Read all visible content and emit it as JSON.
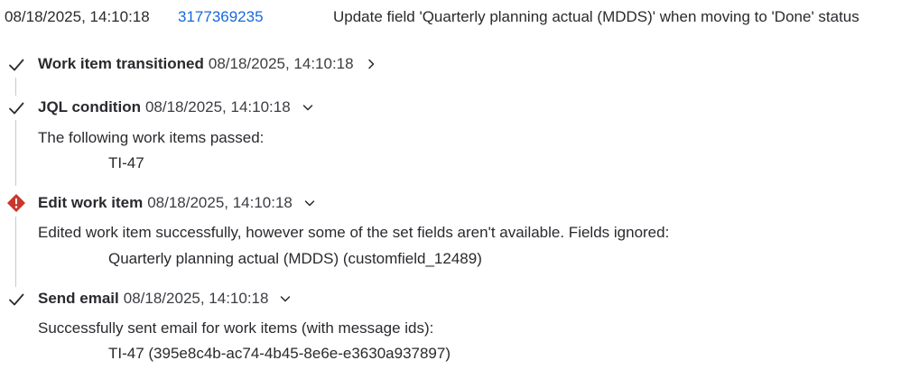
{
  "header": {
    "timestamp": "08/18/2025, 14:10:18",
    "audit_id": "3177369235",
    "rule_name": "Update field 'Quarterly planning actual (MDDS)' when moving to 'Done' status"
  },
  "steps": [
    {
      "status": "success",
      "title": "Work item transitioned",
      "timestamp": "08/18/2025, 14:10:18",
      "chevron": "right"
    },
    {
      "status": "success",
      "title": "JQL condition",
      "timestamp": "08/18/2025, 14:10:18",
      "chevron": "down",
      "message": "The following work items passed:",
      "detail": "TI-47"
    },
    {
      "status": "error",
      "title": "Edit work item",
      "timestamp": "08/18/2025, 14:10:18",
      "chevron": "down",
      "message": "Edited work item successfully, however some of the set fields aren't available. Fields ignored:",
      "detail": "Quarterly planning actual (MDDS) (customfield_12489)"
    },
    {
      "status": "success",
      "title": "Send email",
      "timestamp": "08/18/2025, 14:10:18",
      "chevron": "down",
      "message": "Successfully sent email for work items (with message ids):",
      "detail": "TI-47 (395e8c4b-ac74-4b45-8e6e-e3630a937897)"
    }
  ],
  "colors": {
    "link": "#1868db",
    "error": "#c9372c",
    "text": "#292a2e",
    "line": "#c7c9cf"
  },
  "icons": {
    "success": "check-icon",
    "error": "error-diamond-icon",
    "expand": "chevron-down-icon",
    "collapsed": "chevron-right-icon"
  }
}
